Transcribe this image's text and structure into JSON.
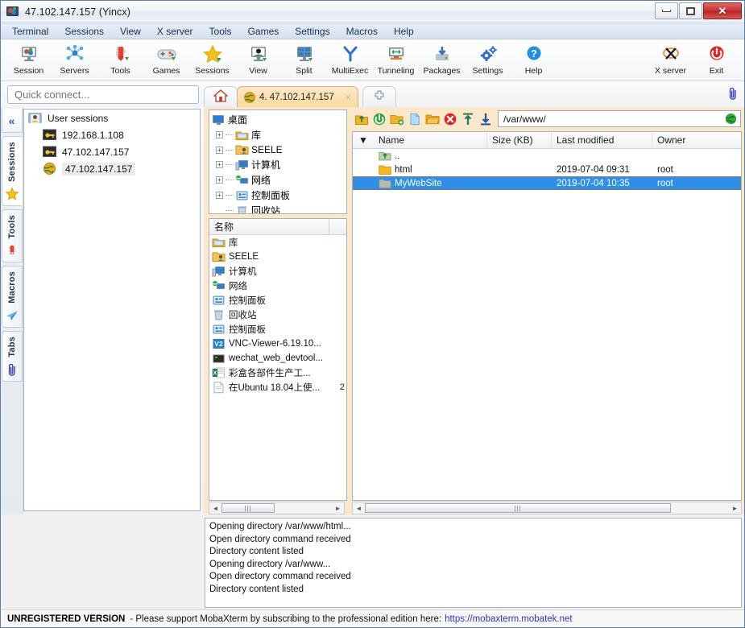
{
  "window": {
    "title": "47.102.147.157 (Yincx)",
    "app_icon": "mobaxterm-icon",
    "controls": {
      "minimize": "minimize-icon",
      "maximize": "maximize-icon",
      "close": "close-icon"
    }
  },
  "menubar": {
    "items": [
      "Terminal",
      "Sessions",
      "View",
      "X server",
      "Tools",
      "Games",
      "Settings",
      "Macros",
      "Help"
    ]
  },
  "toolbar": {
    "left_buttons": [
      {
        "label": "Session",
        "icon": "session-icon"
      },
      {
        "label": "Servers",
        "icon": "servers-icon"
      },
      {
        "label": "Tools",
        "icon": "tools-icon"
      },
      {
        "label": "Games",
        "icon": "games-icon"
      },
      {
        "label": "Sessions",
        "icon": "sessions-star-icon"
      },
      {
        "label": "View",
        "icon": "view-icon"
      },
      {
        "label": "Split",
        "icon": "split-icon"
      },
      {
        "label": "MultiExec",
        "icon": "multiexec-icon"
      },
      {
        "label": "Tunneling",
        "icon": "tunneling-icon"
      },
      {
        "label": "Packages",
        "icon": "packages-icon"
      },
      {
        "label": "Settings",
        "icon": "settings-gear-icon"
      },
      {
        "label": "Help",
        "icon": "help-icon"
      }
    ],
    "right_buttons": [
      {
        "label": "X server",
        "icon": "xserver-icon"
      },
      {
        "label": "Exit",
        "icon": "exit-power-icon"
      }
    ]
  },
  "quick_connect": {
    "placeholder": "Quick connect...",
    "value": ""
  },
  "tabs": {
    "home": {
      "label": "",
      "icon": "home-icon"
    },
    "items": [
      {
        "label": "4. 47.102.147.157",
        "icon": "globe-icon",
        "close": "×",
        "active": true
      }
    ],
    "add": {
      "label": "✚",
      "icon": "new-tab-icon"
    },
    "clip": {
      "icon": "paperclip-icon"
    }
  },
  "sidebar": {
    "collapse": "«",
    "vtabs": [
      {
        "label": "Sessions",
        "icon": "star-icon",
        "active": true
      },
      {
        "label": "Tools",
        "icon": "swissknife-icon",
        "active": false
      },
      {
        "label": "Macros",
        "icon": "paperplane-icon",
        "active": false
      },
      {
        "label": "Tabs",
        "icon": "paperclip-icon",
        "active": false
      }
    ],
    "tree": {
      "root": {
        "label": "User sessions",
        "icon": "user-sessions-icon"
      },
      "children": [
        {
          "label": "192.168.1.108",
          "icon": "ssh-key-icon",
          "selected": false
        },
        {
          "label": "47.102.147.157",
          "icon": "ssh-key-icon",
          "selected": false
        },
        {
          "label": "47.102.147.157",
          "icon": "globe-icon",
          "selected": true
        }
      ]
    }
  },
  "local_browser": {
    "tree_root": {
      "label": "桌面",
      "icon": "desktop-icon"
    },
    "tree_items": [
      {
        "label": "库",
        "icon": "library-icon",
        "expandable": true
      },
      {
        "label": "SEELE",
        "icon": "user-folder-icon",
        "expandable": true
      },
      {
        "label": "计算机",
        "icon": "computer-icon",
        "expandable": true
      },
      {
        "label": "网络",
        "icon": "network-icon",
        "expandable": true
      },
      {
        "label": "控制面板",
        "icon": "control-panel-icon",
        "expandable": true
      },
      {
        "label": "回收站",
        "icon": "recycle-bin-icon",
        "expandable": false
      }
    ],
    "list_header": "名称",
    "list_rows": [
      {
        "name": "库",
        "icon": "library-icon",
        "size": ""
      },
      {
        "name": "SEELE",
        "icon": "user-folder-icon",
        "size": ""
      },
      {
        "name": "计算机",
        "icon": "computer-icon",
        "size": ""
      },
      {
        "name": "网络",
        "icon": "network-icon",
        "size": ""
      },
      {
        "name": "控制面板",
        "icon": "control-panel-icon",
        "size": ""
      },
      {
        "name": "回收站",
        "icon": "recycle-bin-icon",
        "size": ""
      },
      {
        "name": "控制面板",
        "icon": "control-panel-icon",
        "size": ""
      },
      {
        "name": "VNC-Viewer-6.19.10...",
        "icon": "vnc-icon",
        "size": ""
      },
      {
        "name": "wechat_web_devtool...",
        "icon": "app-icon",
        "size": ""
      },
      {
        "name": "彩盒各部件生产工...",
        "icon": "excel-icon",
        "size": ""
      },
      {
        "name": "在Ubuntu 18.04上使...",
        "icon": "document-icon",
        "size": "2"
      }
    ],
    "hscroll": {
      "left_arrow": "◄",
      "right_arrow": "►",
      "grip": "⫿ff"
    }
  },
  "sftp": {
    "toolbar_icons": [
      "go-up-icon",
      "refresh-icon",
      "new-folder-icon",
      "new-file-icon",
      "open-folder-icon",
      "delete-icon",
      "upload-icon",
      "download-icon"
    ],
    "path": "/var/www/",
    "path_globe": "globe-icon",
    "columns": [
      "Name",
      "Size (KB)",
      "Last modified",
      "Owner"
    ],
    "sort_arrow": "▼",
    "rows": [
      {
        "name": "..",
        "icon": "parent-dir-icon",
        "size": "",
        "modified": "",
        "owner": "",
        "selected": false
      },
      {
        "name": "html",
        "icon": "folder-icon",
        "size": "",
        "modified": "2019-07-04 09:31",
        "owner": "root",
        "selected": false
      },
      {
        "name": "MyWebSite",
        "icon": "folder-icon",
        "size": "",
        "modified": "2019-07-04 10:35",
        "owner": "root",
        "selected": true
      }
    ],
    "hscroll": {
      "left_arrow": "◄",
      "right_arrow": "►"
    }
  },
  "log": {
    "lines": [
      "Opening directory /var/www/html...",
      "Open directory command received",
      "Directory content listed",
      "Opening directory /var/www...",
      "Open directory command received",
      "Directory content listed"
    ]
  },
  "statusbar": {
    "strong": "UNREGISTERED VERSION",
    "text": "-  Please support MobaXterm by subscribing to the professional edition here:",
    "link": "https://mobaxterm.mobatek.net"
  },
  "colors": {
    "tab_orange": "#fbd9a0",
    "selection_blue": "#2f8fe8",
    "link_blue": "#2b36c8",
    "accent_frame": "#fbe7c9"
  }
}
